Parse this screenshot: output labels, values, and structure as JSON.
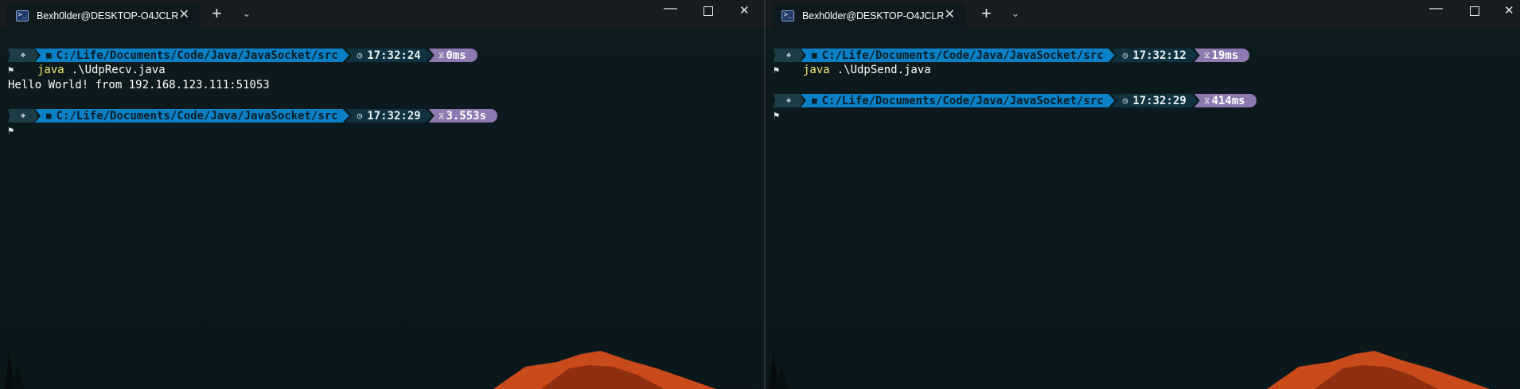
{
  "windows": [
    {
      "tab_title": "Bexh0lder@DESKTOP-O4JCLR",
      "controls": {
        "minimize": "—",
        "close": "✕"
      },
      "new_tab": "+",
      "dropdown": "⌄",
      "prompts": [
        {
          "os_icon": "❖",
          "path": "C:/Life/Documents/Code/Java/JavaSocket/src",
          "time": "17:32:24",
          "exec": "0ms"
        },
        {
          "os_icon": "❖",
          "path": "C:/Life/Documents/Code/Java/JavaSocket/src",
          "time": "17:32:29",
          "exec": "3.553s"
        }
      ],
      "command": {
        "name": "java",
        "arg": ".\\UdpRecv.java"
      },
      "output": "Hello World! from 192.168.123.111:51053"
    },
    {
      "tab_title": "Bexh0lder@DESKTOP-O4JCLR",
      "controls": {
        "minimize": "—",
        "close": "✕"
      },
      "new_tab": "+",
      "dropdown": "⌄",
      "prompts": [
        {
          "os_icon": "❖",
          "path": "C:/Life/Documents/Code/Java/JavaSocket/src",
          "time": "17:32:12",
          "exec": "19ms"
        },
        {
          "os_icon": "❖",
          "path": "C:/Life/Documents/Code/Java/JavaSocket/src",
          "time": "17:32:29",
          "exec": "414ms"
        }
      ],
      "command": {
        "name": "java",
        "arg": ".\\UdpSend.java"
      }
    }
  ],
  "icons": {
    "folder": "■",
    "clock": "◷",
    "hourglass": "⧖",
    "prompt_cursor": "⚑",
    "tab_icon": ">_"
  },
  "colors": {
    "path_segment": "#0a80c6",
    "time_segment": "#10333f",
    "exec_segment": "#8e7ab0",
    "command_name": "#f2e56e",
    "background": "#0b1a1e"
  }
}
